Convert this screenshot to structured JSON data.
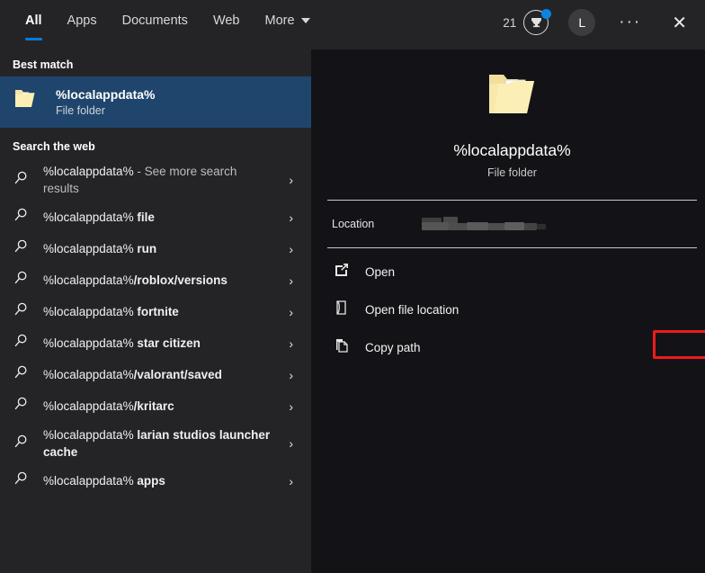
{
  "header": {
    "tabs": [
      {
        "label": "All",
        "active": true,
        "caret": false
      },
      {
        "label": "Apps",
        "active": false,
        "caret": false
      },
      {
        "label": "Documents",
        "active": false,
        "caret": false
      },
      {
        "label": "Web",
        "active": false,
        "caret": false
      },
      {
        "label": "More",
        "active": false,
        "caret": true
      }
    ],
    "rewards_count": "21",
    "rewards_icon": "rewards-trophy-icon",
    "notification_dot": true,
    "avatar_initial": "L",
    "more_label": "···",
    "close_label": "✕",
    "accent_color": "#0a7bd4"
  },
  "left": {
    "best_match_heading": "Best match",
    "best_match": {
      "title": "%localappdata%",
      "subtitle": "File folder",
      "icon": "folder-icon",
      "selected_color": "#1f456c"
    },
    "web_heading": "Search the web",
    "web_items": [
      {
        "icon": "search-icon",
        "prefix": "%localappdata%",
        "suffix": " - See more search results",
        "suffix_bold": false,
        "two_line": true,
        "chevron": "›"
      },
      {
        "icon": "search-icon",
        "prefix": "%localappdata% ",
        "suffix": "file",
        "suffix_bold": true,
        "two_line": false,
        "chevron": "›"
      },
      {
        "icon": "search-icon",
        "prefix": "%localappdata% ",
        "suffix": "run",
        "suffix_bold": true,
        "two_line": false,
        "chevron": "›"
      },
      {
        "icon": "search-icon",
        "prefix": "%localappdata%",
        "suffix": "/roblox/versions",
        "suffix_bold": true,
        "two_line": false,
        "chevron": "›"
      },
      {
        "icon": "search-icon",
        "prefix": "%localappdata% ",
        "suffix": "fortnite",
        "suffix_bold": true,
        "two_line": false,
        "chevron": "›"
      },
      {
        "icon": "search-icon",
        "prefix": "%localappdata% ",
        "suffix": "star citizen",
        "suffix_bold": true,
        "two_line": false,
        "chevron": "›"
      },
      {
        "icon": "search-icon",
        "prefix": "%localappdata%",
        "suffix": "/valorant/saved",
        "suffix_bold": true,
        "two_line": false,
        "chevron": "›"
      },
      {
        "icon": "search-icon",
        "prefix": "%localappdata%",
        "suffix": "/kritarc",
        "suffix_bold": true,
        "two_line": false,
        "chevron": "›"
      },
      {
        "icon": "search-icon",
        "prefix": "%localappdata% ",
        "suffix": "larian studios launcher cache",
        "suffix_bold": true,
        "two_line": true,
        "chevron": "›"
      },
      {
        "icon": "search-icon",
        "prefix": "%localappdata% ",
        "suffix": "apps",
        "suffix_bold": true,
        "two_line": false,
        "chevron": "›"
      }
    ]
  },
  "right": {
    "preview": {
      "icon": "folder-icon",
      "title": "%localappdata%",
      "subtitle": "File folder"
    },
    "location_label": "Location",
    "location_value_redacted": true,
    "actions": [
      {
        "icon": "open-external-icon",
        "label": "Open",
        "highlighted": true
      },
      {
        "icon": "open-file-location-icon",
        "label": "Open file location",
        "highlighted": false
      },
      {
        "icon": "copy-path-icon",
        "label": "Copy path",
        "highlighted": false
      }
    ],
    "highlight_color": "#ee1c1c"
  }
}
